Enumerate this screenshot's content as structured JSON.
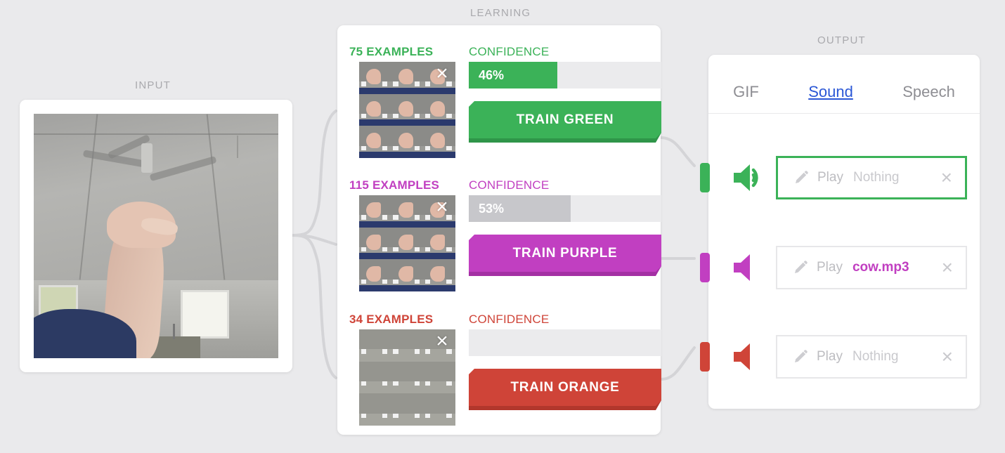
{
  "sections": {
    "input": "INPUT",
    "learning": "LEARNING",
    "output": "OUTPUT"
  },
  "colors": {
    "green": "#3bb258",
    "purple": "#c13fc1",
    "red": "#cf4438",
    "green_dark": "#2f9549",
    "purple_dark": "#a430a4",
    "red_dark": "#b2372c",
    "bar_track": "#ebebed",
    "bar_inactive": "#c7c7cb",
    "page_bg": "#eaeaec",
    "tab_active": "#2b57d6",
    "muted_text": "#a9a9ad"
  },
  "input": {
    "panel_name": "webcam-preview"
  },
  "learning": {
    "confidence_label": "CONFIDENCE",
    "classes": [
      {
        "id": "green",
        "examples_label": "75 EXAMPLES",
        "example_count": 75,
        "confidence_text": "46%",
        "confidence_pct": 46,
        "confidence_active": true,
        "train_label": "TRAIN GREEN",
        "delete_icon": "×",
        "color": "#3bb258",
        "color_dark": "#2f9549"
      },
      {
        "id": "purple",
        "examples_label": "115 EXAMPLES",
        "example_count": 115,
        "confidence_text": "53%",
        "confidence_pct": 53,
        "confidence_active": false,
        "train_label": "TRAIN PURPLE",
        "delete_icon": "×",
        "color": "#c13fc1",
        "color_dark": "#a430a4"
      },
      {
        "id": "red",
        "examples_label": "34 EXAMPLES",
        "example_count": 34,
        "confidence_text": "",
        "confidence_pct": 0,
        "confidence_active": false,
        "train_label": "TRAIN ORANGE",
        "delete_icon": "×",
        "color": "#cf4438",
        "color_dark": "#b2372c"
      }
    ]
  },
  "output": {
    "tabs": [
      {
        "label": "GIF",
        "active": false
      },
      {
        "label": "Sound",
        "active": true
      },
      {
        "label": "Speech",
        "active": false
      }
    ],
    "rows": [
      {
        "id": "green",
        "speaker_icon": "speaker-on-icon",
        "speaker_active": true,
        "edit_icon": "pencil-icon",
        "play_label": "Play",
        "value": "Nothing",
        "value_empty": true,
        "clear_icon": "×",
        "selected": true,
        "color": "#3bb258"
      },
      {
        "id": "purple",
        "speaker_icon": "speaker-muted-icon",
        "speaker_active": false,
        "edit_icon": "pencil-icon",
        "play_label": "Play",
        "value": "cow.mp3",
        "value_empty": false,
        "clear_icon": "×",
        "selected": false,
        "color": "#c13fc1"
      },
      {
        "id": "red",
        "speaker_icon": "speaker-muted-icon",
        "speaker_active": false,
        "edit_icon": "pencil-icon",
        "play_label": "Play",
        "value": "Nothing",
        "value_empty": true,
        "clear_icon": "×",
        "selected": false,
        "color": "#cf4438"
      }
    ]
  }
}
